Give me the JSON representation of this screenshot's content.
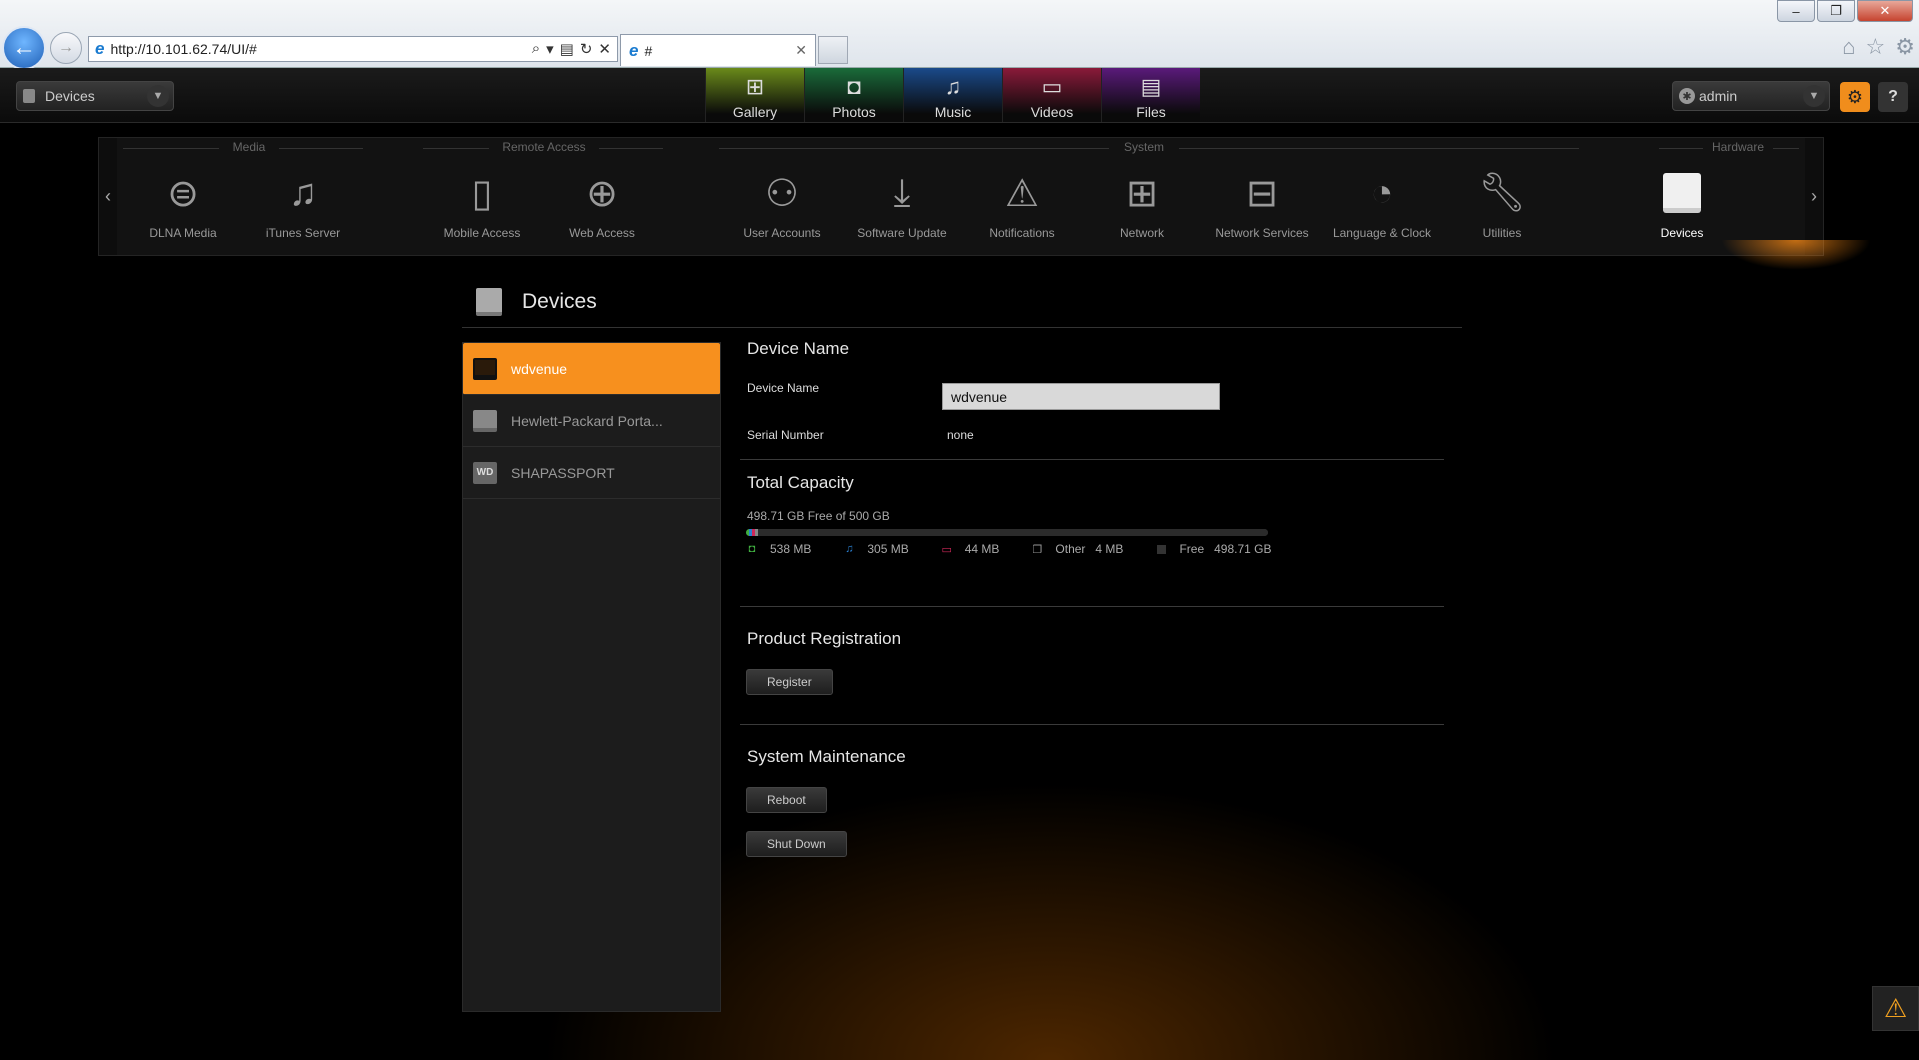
{
  "browser": {
    "window_controls": [
      "–",
      "❐",
      "✕"
    ],
    "address": "http://10.101.62.74/UI/#",
    "tab_title": "#",
    "tab_close": "✕"
  },
  "app": {
    "device_select": "Devices",
    "main_nav": [
      {
        "label": "Gallery",
        "icon": "gallery-icon",
        "color": "#6a8a1a"
      },
      {
        "label": "Photos",
        "icon": "camera-icon",
        "color": "#1a6b3a"
      },
      {
        "label": "Music",
        "icon": "music-icon",
        "color": "#1a4a8a"
      },
      {
        "label": "Videos",
        "icon": "video-icon",
        "color": "#8a1a3a"
      },
      {
        "label": "Files",
        "icon": "files-icon",
        "color": "#5a1a7a"
      }
    ],
    "user": "admin"
  },
  "settings_bar": {
    "groups": [
      "Media",
      "Remote Access",
      "System",
      "Hardware"
    ],
    "items": [
      {
        "label": "DLNA Media",
        "icon": "dlna-icon"
      },
      {
        "label": "iTunes Server",
        "icon": "itunes-icon"
      },
      {
        "label": "Mobile Access",
        "icon": "mobile-icon"
      },
      {
        "label": "Web Access",
        "icon": "globe-icon"
      },
      {
        "label": "User Accounts",
        "icon": "users-icon"
      },
      {
        "label": "Software Update",
        "icon": "download-icon"
      },
      {
        "label": "Notifications",
        "icon": "warning-icon"
      },
      {
        "label": "Network",
        "icon": "network-icon"
      },
      {
        "label": "Network Services",
        "icon": "network-services-icon"
      },
      {
        "label": "Language & Clock",
        "icon": "globe-clock-icon"
      },
      {
        "label": "Utilities",
        "icon": "wrench-icon"
      },
      {
        "label": "Devices",
        "icon": "drive-icon"
      }
    ]
  },
  "page": {
    "title": "Devices",
    "devices": [
      "wdvenue",
      "Hewlett-Packard Porta...",
      "SHAPASSPORT"
    ],
    "device_name_section": "Device Name",
    "device_name_label": "Device Name",
    "device_name_value": "wdvenue",
    "serial_label": "Serial Number",
    "serial_value": "none",
    "capacity_section": "Total Capacity",
    "capacity_summary": "498.71 GB Free of 500 GB",
    "capacity": [
      {
        "name": "photos",
        "label": "538 MB",
        "mb": 538,
        "color": "#3fae3f",
        "icon": "camera-icon"
      },
      {
        "name": "music",
        "label": "305 MB",
        "mb": 305,
        "color": "#2a7fd0",
        "icon": "music-icon"
      },
      {
        "name": "videos",
        "label": "44 MB",
        "mb": 44,
        "color": "#d0285a",
        "icon": "video-icon"
      },
      {
        "name": "other",
        "label": "Other   4 MB",
        "mb": 4,
        "color": "#888888",
        "icon": "files-icon"
      },
      {
        "name": "free",
        "label": "Free   498.71 GB",
        "mb": 498710,
        "color": "#2b2b2b",
        "icon": "square-icon"
      }
    ],
    "registration_section": "Product Registration",
    "register_button": "Register",
    "maintenance_section": "System Maintenance",
    "reboot_button": "Reboot",
    "shutdown_button": "Shut Down"
  },
  "colors": {
    "accent": "#f7901e"
  }
}
